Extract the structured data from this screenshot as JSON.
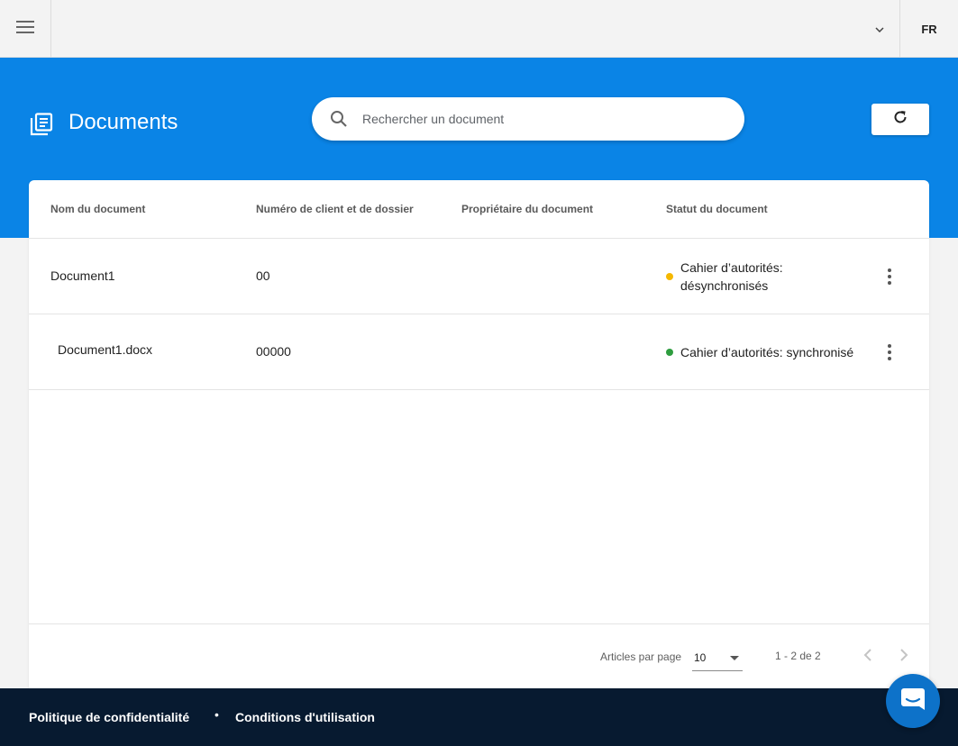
{
  "topbar": {
    "language": "FR"
  },
  "header": {
    "title": "Documents",
    "search_placeholder": "Rechercher un document"
  },
  "table": {
    "columns": [
      "Nom du document",
      "Numéro de client et de dossier",
      "Propriétaire du document",
      "Statut du document"
    ],
    "rows": [
      {
        "name": "Document1",
        "client_matter": "00",
        "owner": "",
        "status_line1": "Cahier d’autorités:",
        "status_line2": "désynchronisés",
        "status_color": "#f5b800"
      },
      {
        "name": "Document1.docx",
        "client_matter": "00000",
        "owner": "",
        "status_line1": "Cahier d’autorités: synchronisé",
        "status_line2": "",
        "status_color": "#2e9d3f"
      }
    ]
  },
  "pagination": {
    "per_page_label": "Articles par page",
    "per_page_value": "10",
    "range": "1 - 2 de 2"
  },
  "footer": {
    "privacy": "Politique de confidentialité",
    "separator": "•",
    "terms": "Conditions d'utilisation"
  },
  "colors": {
    "brand_blue": "#0a84e6",
    "footer_bg": "#071a30",
    "chat_bg": "#0d72c9"
  }
}
